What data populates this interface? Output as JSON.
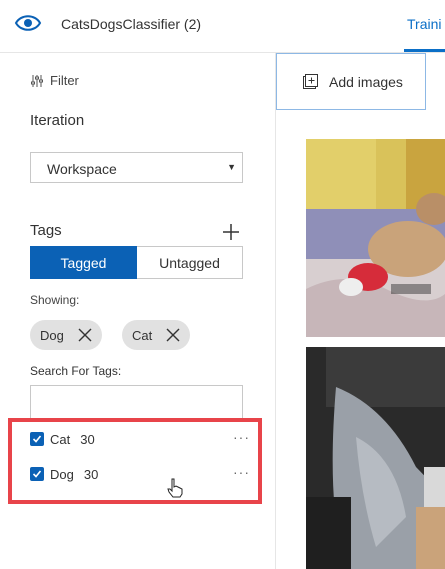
{
  "header": {
    "app_icon": "eye-icon",
    "title": "CatsDogsClassifier (2)",
    "tab_training": "Traini"
  },
  "sidebar": {
    "filter_label": "Filter",
    "iteration_label": "Iteration",
    "iteration_value": "Workspace",
    "tags_label": "Tags",
    "toggle": {
      "tagged": "Tagged",
      "untagged": "Untagged"
    },
    "showing_label": "Showing:",
    "chips": [
      {
        "label": "Dog"
      },
      {
        "label": "Cat"
      }
    ],
    "search_label": "Search For Tags:",
    "search_value": "",
    "tag_list": [
      {
        "name": "Cat",
        "count": "30",
        "checked": true
      },
      {
        "name": "Dog",
        "count": "30",
        "checked": true
      }
    ],
    "more_glyph": "···"
  },
  "main": {
    "add_images_label": "Add images"
  },
  "colors": {
    "accent": "#0b61b5",
    "link": "#0b6fc7",
    "highlight": "#e8444a"
  }
}
